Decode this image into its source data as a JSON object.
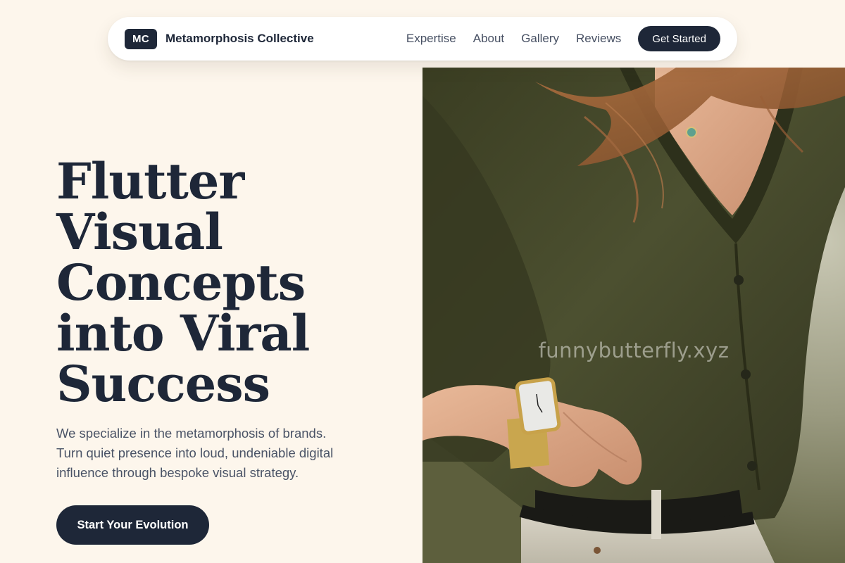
{
  "navbar": {
    "logo_text": "MC",
    "brand_name": "Metamorphosis Collective",
    "links": [
      "Expertise",
      "About",
      "Gallery",
      "Reviews"
    ],
    "cta_label": "Get Started"
  },
  "hero": {
    "title_lines": [
      "Flutter",
      "Visual",
      "Concepts",
      "into Viral",
      "Success"
    ],
    "subtitle_lines": [
      "We specialize in the metamorphosis of brands.",
      "Turn quiet presence into loud, undeniable digital",
      "influence through bespoke visual strategy."
    ],
    "cta_label": "Start Your Evolution",
    "image_watermark": "funnybutterfly.xyz"
  },
  "colors": {
    "background": "#fdf6ec",
    "primary_dark": "#1e2738",
    "body_text": "#4a5366",
    "nav_text": "#475063"
  }
}
